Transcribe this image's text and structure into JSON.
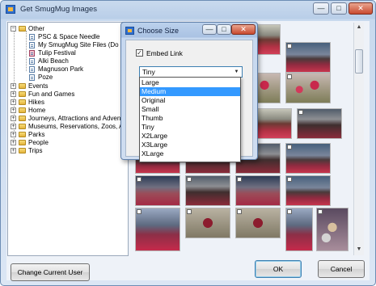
{
  "window": {
    "title": "Get SmugMug Images"
  },
  "tree": {
    "items": [
      {
        "label": "Other",
        "expander": "−"
      },
      {
        "label": "PSC & Space Needle"
      },
      {
        "label": "My SmugMug Site Files (Do N"
      },
      {
        "label": "Tulip Festival"
      },
      {
        "label": "Alki Beach"
      },
      {
        "label": "Magnuson Park"
      },
      {
        "label": "Poze"
      },
      {
        "label": "Events",
        "expander": "+"
      },
      {
        "label": "Fun and Games",
        "expander": "+"
      },
      {
        "label": "Hikes",
        "expander": "+"
      },
      {
        "label": "Home",
        "expander": "+"
      },
      {
        "label": "Journeys, Attractions and Advent",
        "expander": "+"
      },
      {
        "label": "Museums, Reservations, Zoos, Aqu",
        "expander": "+"
      },
      {
        "label": "Parks",
        "expander": "+"
      },
      {
        "label": "People",
        "expander": "+"
      },
      {
        "label": "Trips",
        "expander": "+"
      }
    ]
  },
  "dialog": {
    "title": "Choose Size",
    "embed_label": "Embed Link",
    "embed_checked": "✓",
    "size_value": "Tiny",
    "dropdown_arrow": "▼",
    "options": [
      "Large",
      "Medium",
      "Original",
      "Small",
      "Thumb",
      "Tiny",
      "X2Large",
      "X3Large",
      "XLarge"
    ],
    "highlighted": "Medium",
    "caption_buttons": {
      "minimize": "—",
      "maximize": "□",
      "close": "✕"
    }
  },
  "caption_buttons": {
    "minimize": "—",
    "maximize": "□",
    "close": "✕"
  },
  "buttons": {
    "change_user": "Change Current User",
    "ok": "OK",
    "cancel": "Cancel"
  },
  "scrollbar": {
    "up": "▲",
    "down": "▼"
  },
  "colors": {
    "selection": "#3399ff",
    "window_frame": "#b9cee8"
  }
}
